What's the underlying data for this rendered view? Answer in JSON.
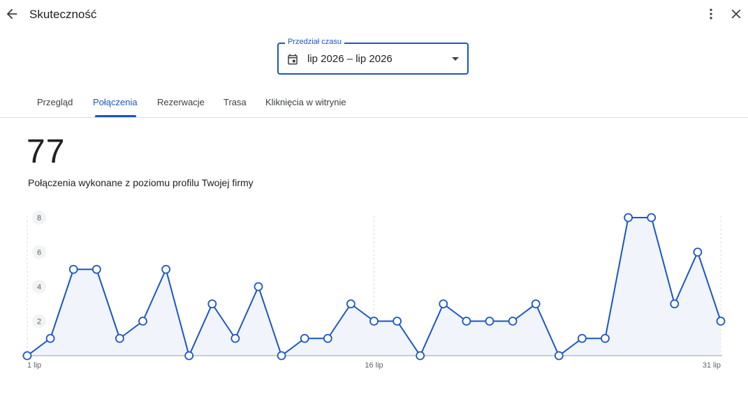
{
  "header": {
    "title": "Skuteczność",
    "icons": [
      "arrow-back-icon",
      "more-vert-icon",
      "close-icon"
    ]
  },
  "date_range": {
    "label": "Przedział czasu",
    "value": "lip 2026 – lip 2026",
    "icons": [
      "calendar-icon",
      "dropdown-arrow-icon"
    ]
  },
  "tabs": [
    {
      "label": "Przegląd",
      "active": false
    },
    {
      "label": "Połączenia",
      "active": true
    },
    {
      "label": "Rezerwacje",
      "active": false
    },
    {
      "label": "Trasa",
      "active": false
    },
    {
      "label": "Kliknięcia w witrynie",
      "active": false
    }
  ],
  "stats": {
    "total": "77",
    "description": "Połączenia wykonane z poziomu profilu Twojej firmy"
  },
  "colors": {
    "accent": "#1a56c4",
    "area_fill": "#f1f4fb"
  },
  "chart_data": {
    "type": "line",
    "x": [
      1,
      2,
      3,
      4,
      5,
      6,
      7,
      8,
      9,
      10,
      11,
      12,
      13,
      14,
      15,
      16,
      17,
      18,
      19,
      20,
      21,
      22,
      23,
      24,
      25,
      26,
      27,
      28,
      29,
      30,
      31
    ],
    "values": [
      0,
      1,
      5,
      5,
      1,
      2,
      5,
      0,
      3,
      1,
      4,
      0,
      1,
      1,
      3,
      2,
      2,
      0,
      3,
      2,
      2,
      2,
      3,
      0,
      1,
      1,
      8,
      8,
      3,
      6,
      2
    ],
    "x_tick_labels": [
      "1 lip",
      "16 lip",
      "31 lip"
    ],
    "x_tick_positions": [
      1,
      16,
      31
    ],
    "y_tick_labels": [
      "2",
      "4",
      "6",
      "8"
    ],
    "y_ticks": [
      2,
      4,
      6,
      8
    ],
    "ylim": [
      0,
      8
    ],
    "grid": "vertical-dashed",
    "area_fill": true
  }
}
